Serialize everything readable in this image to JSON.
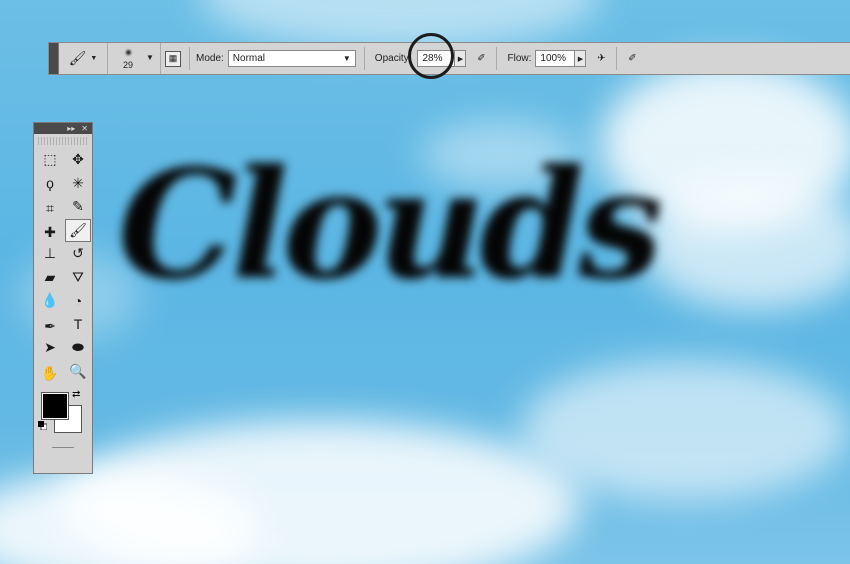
{
  "canvas": {
    "artwork_text": "Clouds",
    "sky_color": "#5bb6e3"
  },
  "options_bar": {
    "brush_size": "29",
    "mode_label": "Mode:",
    "mode_value": "Normal",
    "opacity_label": "Opacity:",
    "opacity_value": "28%",
    "flow_label": "Flow:",
    "flow_value": "100%",
    "highlight_color": "#1c1c1c"
  },
  "tools_panel": {
    "header_icons": [
      "expand-icon",
      "close-icon"
    ],
    "foreground_color": "#000000",
    "background_color": "#ffffff",
    "tools": [
      {
        "name": "marquee-tool",
        "glyph": "⬚"
      },
      {
        "name": "move-tool",
        "glyph": "✥"
      },
      {
        "name": "lasso-tool",
        "glyph": "ϙ"
      },
      {
        "name": "magic-wand-tool",
        "glyph": "✳"
      },
      {
        "name": "crop-tool",
        "glyph": "⌗"
      },
      {
        "name": "eyedropper-tool",
        "glyph": "✎"
      },
      {
        "name": "healing-brush-tool",
        "glyph": "✚"
      },
      {
        "name": "brush-tool",
        "glyph": "🖌"
      },
      {
        "name": "clone-stamp-tool",
        "glyph": "⊥"
      },
      {
        "name": "history-brush-tool",
        "glyph": "↺"
      },
      {
        "name": "eraser-tool",
        "glyph": "▰"
      },
      {
        "name": "paint-bucket-tool",
        "glyph": "⛛"
      },
      {
        "name": "blur-tool",
        "glyph": "💧"
      },
      {
        "name": "dodge-tool",
        "glyph": "◔"
      },
      {
        "name": "pen-tool",
        "glyph": "✒"
      },
      {
        "name": "type-tool",
        "glyph": "T"
      },
      {
        "name": "path-selection-tool",
        "glyph": "➤"
      },
      {
        "name": "shape-tool",
        "glyph": "⬬"
      },
      {
        "name": "hand-tool",
        "glyph": "✋"
      },
      {
        "name": "zoom-tool",
        "glyph": "🔍"
      }
    ]
  }
}
